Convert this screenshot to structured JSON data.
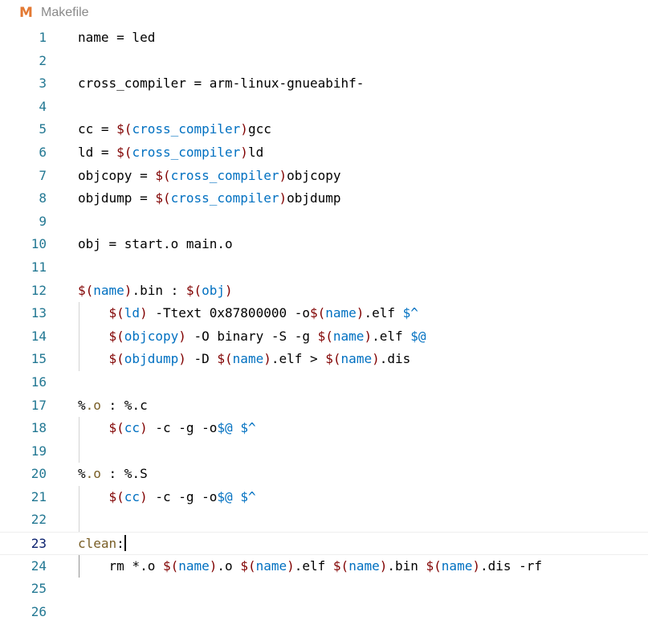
{
  "tab": {
    "icon": "M",
    "filename": "Makefile"
  },
  "colors": {
    "variable": "#0070c1",
    "dollar": "#800000",
    "line_number": "#237893",
    "icon": "#e37933"
  },
  "editor": {
    "current_line": 23,
    "lines": [
      {
        "number": "1",
        "segments": [
          {
            "text": "name = led",
            "kind": "plain"
          }
        ]
      },
      {
        "number": "2",
        "segments": []
      },
      {
        "number": "3",
        "segments": [
          {
            "text": "cross_compiler = arm-linux-gnueabihf-",
            "kind": "plain"
          }
        ]
      },
      {
        "number": "4",
        "segments": []
      },
      {
        "number": "5",
        "segments": [
          {
            "text": "cc = ",
            "kind": "plain"
          },
          {
            "text": "$(",
            "kind": "dollar"
          },
          {
            "text": "cross_compiler",
            "kind": "var"
          },
          {
            "text": ")",
            "kind": "dollar"
          },
          {
            "text": "gcc",
            "kind": "plain"
          }
        ]
      },
      {
        "number": "6",
        "segments": [
          {
            "text": "ld = ",
            "kind": "plain"
          },
          {
            "text": "$(",
            "kind": "dollar"
          },
          {
            "text": "cross_compiler",
            "kind": "var"
          },
          {
            "text": ")",
            "kind": "dollar"
          },
          {
            "text": "ld",
            "kind": "plain"
          }
        ]
      },
      {
        "number": "7",
        "segments": [
          {
            "text": "objcopy = ",
            "kind": "plain"
          },
          {
            "text": "$(",
            "kind": "dollar"
          },
          {
            "text": "cross_compiler",
            "kind": "var"
          },
          {
            "text": ")",
            "kind": "dollar"
          },
          {
            "text": "objcopy",
            "kind": "plain"
          }
        ]
      },
      {
        "number": "8",
        "segments": [
          {
            "text": "objdump = ",
            "kind": "plain"
          },
          {
            "text": "$(",
            "kind": "dollar"
          },
          {
            "text": "cross_compiler",
            "kind": "var"
          },
          {
            "text": ")",
            "kind": "dollar"
          },
          {
            "text": "objdump",
            "kind": "plain"
          }
        ]
      },
      {
        "number": "9",
        "segments": []
      },
      {
        "number": "10",
        "segments": [
          {
            "text": "obj = start.o main.o",
            "kind": "plain"
          }
        ]
      },
      {
        "number": "11",
        "segments": []
      },
      {
        "number": "12",
        "segments": [
          {
            "text": "$(",
            "kind": "dollar"
          },
          {
            "text": "name",
            "kind": "var"
          },
          {
            "text": ")",
            "kind": "dollar"
          },
          {
            "text": ".bin : ",
            "kind": "plain"
          },
          {
            "text": "$(",
            "kind": "dollar"
          },
          {
            "text": "obj",
            "kind": "var"
          },
          {
            "text": ")",
            "kind": "dollar"
          }
        ]
      },
      {
        "number": "13",
        "indent": true,
        "segments": [
          {
            "text": "    ",
            "kind": "plain"
          },
          {
            "text": "$(",
            "kind": "dollar"
          },
          {
            "text": "ld",
            "kind": "var"
          },
          {
            "text": ")",
            "kind": "dollar"
          },
          {
            "text": " -Ttext 0x87800000 -o",
            "kind": "plain"
          },
          {
            "text": "$(",
            "kind": "dollar"
          },
          {
            "text": "name",
            "kind": "var"
          },
          {
            "text": ")",
            "kind": "dollar"
          },
          {
            "text": ".elf ",
            "kind": "plain"
          },
          {
            "text": "$^",
            "kind": "var"
          }
        ]
      },
      {
        "number": "14",
        "indent": true,
        "segments": [
          {
            "text": "    ",
            "kind": "plain"
          },
          {
            "text": "$(",
            "kind": "dollar"
          },
          {
            "text": "objcopy",
            "kind": "var"
          },
          {
            "text": ")",
            "kind": "dollar"
          },
          {
            "text": " -O binary -S -g ",
            "kind": "plain"
          },
          {
            "text": "$(",
            "kind": "dollar"
          },
          {
            "text": "name",
            "kind": "var"
          },
          {
            "text": ")",
            "kind": "dollar"
          },
          {
            "text": ".elf ",
            "kind": "plain"
          },
          {
            "text": "$@",
            "kind": "var"
          }
        ]
      },
      {
        "number": "15",
        "indent": true,
        "segments": [
          {
            "text": "    ",
            "kind": "plain"
          },
          {
            "text": "$(",
            "kind": "dollar"
          },
          {
            "text": "objdump",
            "kind": "var"
          },
          {
            "text": ")",
            "kind": "dollar"
          },
          {
            "text": " -D ",
            "kind": "plain"
          },
          {
            "text": "$(",
            "kind": "dollar"
          },
          {
            "text": "name",
            "kind": "var"
          },
          {
            "text": ")",
            "kind": "dollar"
          },
          {
            "text": ".elf > ",
            "kind": "plain"
          },
          {
            "text": "$(",
            "kind": "dollar"
          },
          {
            "text": "name",
            "kind": "var"
          },
          {
            "text": ")",
            "kind": "dollar"
          },
          {
            "text": ".dis",
            "kind": "plain"
          }
        ]
      },
      {
        "number": "16",
        "segments": []
      },
      {
        "number": "17",
        "segments": [
          {
            "text": "%",
            "kind": "plain"
          },
          {
            "text": ".o",
            "kind": "label"
          },
          {
            "text": " : %.c",
            "kind": "plain"
          }
        ]
      },
      {
        "number": "18",
        "indent": true,
        "segments": [
          {
            "text": "    ",
            "kind": "plain"
          },
          {
            "text": "$(",
            "kind": "dollar"
          },
          {
            "text": "cc",
            "kind": "var"
          },
          {
            "text": ")",
            "kind": "dollar"
          },
          {
            "text": " -c -g -o",
            "kind": "plain"
          },
          {
            "text": "$@",
            "kind": "var"
          },
          {
            "text": " ",
            "kind": "plain"
          },
          {
            "text": "$^",
            "kind": "var"
          }
        ]
      },
      {
        "number": "19",
        "indent": true,
        "segments": []
      },
      {
        "number": "20",
        "segments": [
          {
            "text": "%",
            "kind": "plain"
          },
          {
            "text": ".o",
            "kind": "label"
          },
          {
            "text": " : %.S",
            "kind": "plain"
          }
        ]
      },
      {
        "number": "21",
        "indent": true,
        "segments": [
          {
            "text": "    ",
            "kind": "plain"
          },
          {
            "text": "$(",
            "kind": "dollar"
          },
          {
            "text": "cc",
            "kind": "var"
          },
          {
            "text": ")",
            "kind": "dollar"
          },
          {
            "text": " -c -g -o",
            "kind": "plain"
          },
          {
            "text": "$@",
            "kind": "var"
          },
          {
            "text": " ",
            "kind": "plain"
          },
          {
            "text": "$^",
            "kind": "var"
          }
        ]
      },
      {
        "number": "22",
        "indent": true,
        "segments": []
      },
      {
        "number": "23",
        "cursor_after": true,
        "segments": [
          {
            "text": "clean",
            "kind": "label"
          },
          {
            "text": ":",
            "kind": "plain"
          }
        ]
      },
      {
        "number": "24",
        "indent": true,
        "indent_active": true,
        "segments": [
          {
            "text": "    rm *.o ",
            "kind": "plain"
          },
          {
            "text": "$(",
            "kind": "dollar"
          },
          {
            "text": "name",
            "kind": "var"
          },
          {
            "text": ")",
            "kind": "dollar"
          },
          {
            "text": ".o ",
            "kind": "plain"
          },
          {
            "text": "$(",
            "kind": "dollar"
          },
          {
            "text": "name",
            "kind": "var"
          },
          {
            "text": ")",
            "kind": "dollar"
          },
          {
            "text": ".elf ",
            "kind": "plain"
          },
          {
            "text": "$(",
            "kind": "dollar"
          },
          {
            "text": "name",
            "kind": "var"
          },
          {
            "text": ")",
            "kind": "dollar"
          },
          {
            "text": ".bin ",
            "kind": "plain"
          },
          {
            "text": "$(",
            "kind": "dollar"
          },
          {
            "text": "name",
            "kind": "var"
          },
          {
            "text": ")",
            "kind": "dollar"
          },
          {
            "text": ".dis -rf",
            "kind": "plain"
          }
        ]
      },
      {
        "number": "25",
        "segments": []
      },
      {
        "number": "26",
        "segments": []
      }
    ]
  }
}
